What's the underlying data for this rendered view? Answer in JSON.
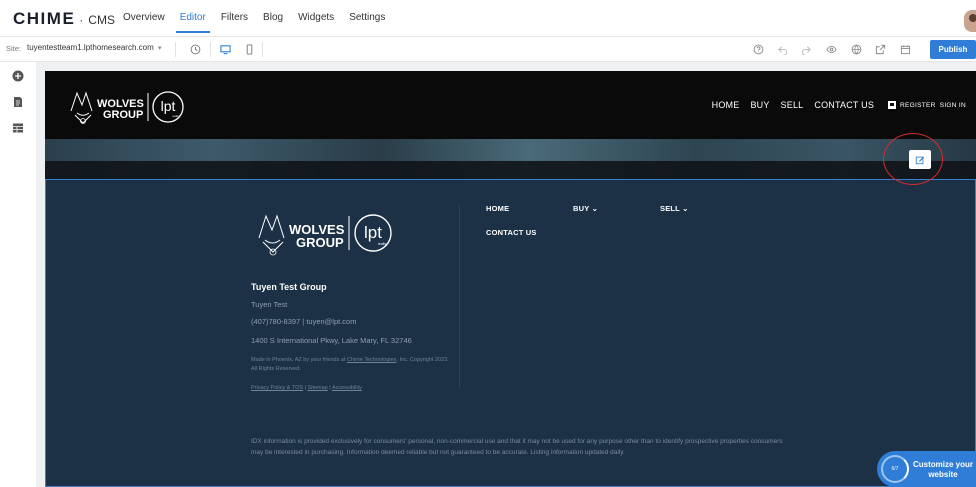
{
  "brand": {
    "logo": "CHIME",
    "separator": "·",
    "product": "CMS"
  },
  "nav": {
    "tabs": [
      "Overview",
      "Editor",
      "Filters",
      "Blog",
      "Widgets",
      "Settings"
    ],
    "active": "Editor"
  },
  "toolbar": {
    "site_label": "Site:",
    "site_value": "tuyentestteam1.lpthomesearch.com",
    "publish_label": "Publish",
    "icons": [
      "history-icon",
      "desktop-icon",
      "mobile-icon",
      "help-icon",
      "undo-icon",
      "redo-icon",
      "preview-icon",
      "globe-icon",
      "external-link-icon",
      "calendar-icon"
    ]
  },
  "sidebar": {
    "icons": [
      "add-icon",
      "pages-icon",
      "layout-icon"
    ]
  },
  "site": {
    "header_nav": [
      "HOME",
      "BUY",
      "SELL",
      "CONTACT US"
    ],
    "register": "REGISTER",
    "signin": "SIGN IN",
    "logo": {
      "top": "WOLVES",
      "bottom": "GROUP",
      "badge": "lpt",
      "badge_sub": "realty"
    }
  },
  "footer": {
    "name": "Tuyen Test Group",
    "person": "Tuyen Test",
    "contact": "(407)780-8397  |  tuyen@lpt.com",
    "address": "1400 S International Pkwy, Lake Mary, FL 32746",
    "legal_prefix": "Made in Phoenix, AZ by your friends at ",
    "legal_link": "Chime Technologies",
    "legal_suffix": ", Inc. Copyright 2023. All Rights Reserved.",
    "links": [
      "Privacy Policy & TOS",
      "Sitemap",
      "Accessibility"
    ],
    "nav": {
      "home": "HOME",
      "buy": "BUY ⌄",
      "sell": "SELL ⌄",
      "contact": "CONTACT US"
    },
    "idx": "IDX information is provided exclusively for consumers' personal, non-commercial use and that it may not be used for any purpose other than to identify prospective properties consumers may be interested in purchasing. Information deemed reliable but not guaranteed to be accurate. Listing information updated daily."
  },
  "customize": {
    "progress": "6/7",
    "label": "Customize your website"
  },
  "colors": {
    "accent": "#2f7dd6",
    "footer_bg": "#1c3146",
    "highlight_ring": "#d92c2c"
  }
}
